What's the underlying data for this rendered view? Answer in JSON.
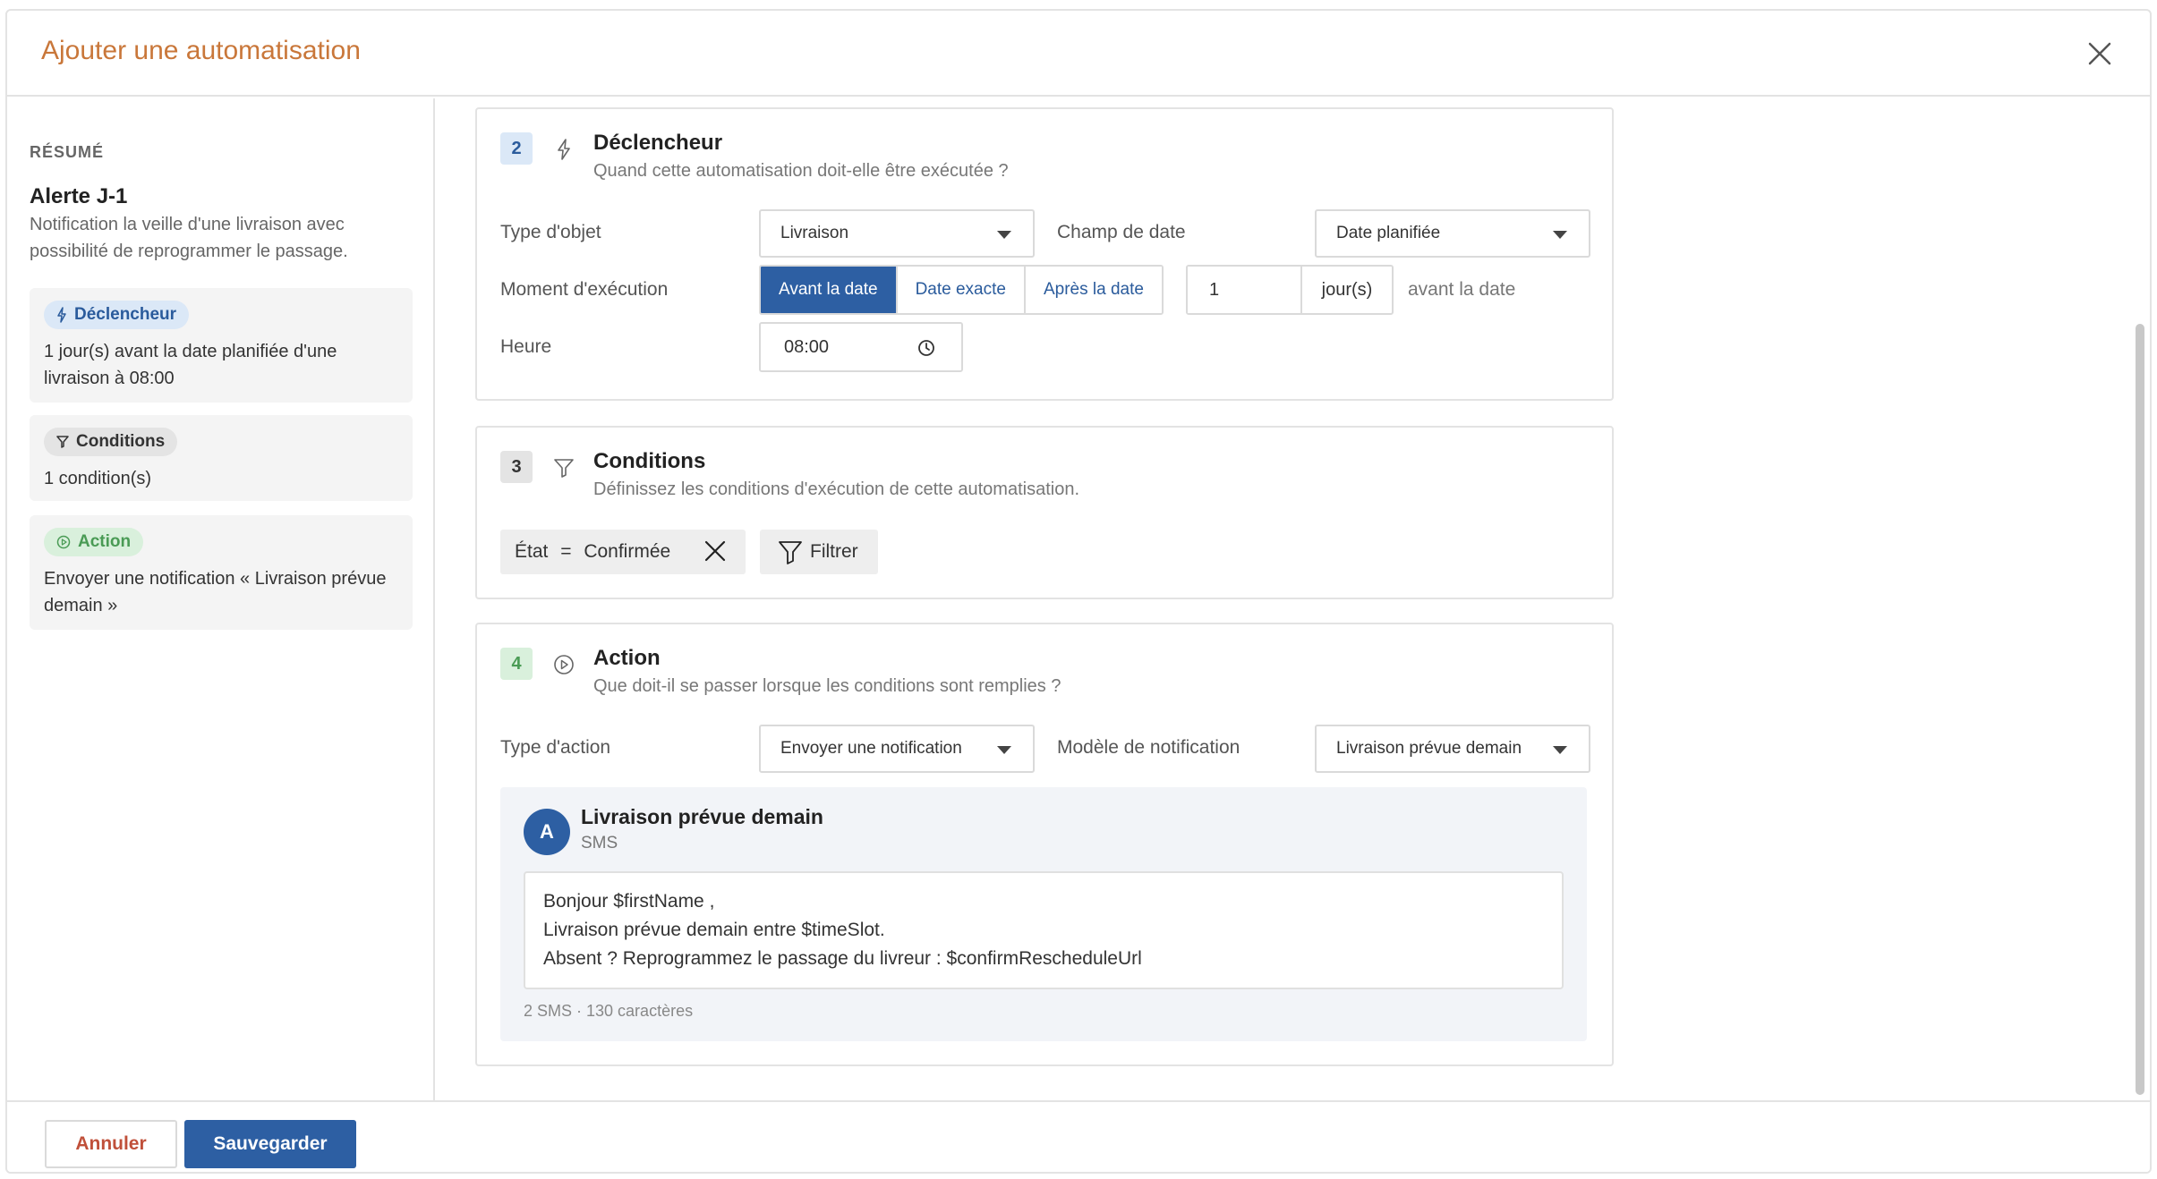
{
  "modal": {
    "title": "Ajouter une automatisation"
  },
  "sidebar": {
    "section_label": "RÉSUMÉ",
    "name": "Alerte J-1",
    "description": "Notification la veille d'une livraison avec possibilité de reprogrammer le passage.",
    "cards": [
      {
        "label": "Déclencheur",
        "text": "1 jour(s) avant la date planifiée d'une livraison à 08:00"
      },
      {
        "label": "Conditions",
        "text": "1 condition(s)"
      },
      {
        "label": "Action",
        "text": "Envoyer une notification « Livraison prévue demain »"
      }
    ]
  },
  "trigger": {
    "step": "2",
    "title": "Déclencheur",
    "subtitle": "Quand cette automatisation doit-elle être exécutée ?",
    "object_type_label": "Type d'objet",
    "object_type_value": "Livraison",
    "date_field_label": "Champ de date",
    "date_field_value": "Date planifiée",
    "moment_label": "Moment d'exécution",
    "moment_options": [
      "Avant la date",
      "Date exacte",
      "Après la date"
    ],
    "moment_selected": "Avant la date",
    "offset_value": "1",
    "offset_unit": "jour(s)",
    "offset_suffix": "avant la date",
    "time_label": "Heure",
    "time_value": "08:00"
  },
  "conditions": {
    "step": "3",
    "title": "Conditions",
    "subtitle": "Définissez les conditions d'exécution de cette automatisation.",
    "chip": {
      "field": "État",
      "operator": "=",
      "value": "Confirmée"
    },
    "filter_label": "Filtrer"
  },
  "action": {
    "step": "4",
    "title": "Action",
    "subtitle": "Que doit-il se passer lorsque les conditions sont remplies ?",
    "action_type_label": "Type d'action",
    "action_type_value": "Envoyer une notification",
    "template_label": "Modèle de notification",
    "template_value": "Livraison prévue demain",
    "preview": {
      "avatar": "A",
      "name": "Livraison prévue demain",
      "channel": "SMS",
      "lines": [
        "Bonjour $firstName ,",
        "Livraison prévue demain entre $timeSlot.",
        "Absent ? Reprogrammez le passage du livreur : $confirmRescheduleUrl"
      ],
      "count": "2 SMS · 130 caractères"
    }
  },
  "footer": {
    "cancel_label": "Annuler",
    "save_label": "Sauvegarder"
  },
  "colors": {
    "accent": "#2d5fa3",
    "title": "#c9773a",
    "danger": "#c0503a",
    "success": "#4a9b55"
  }
}
